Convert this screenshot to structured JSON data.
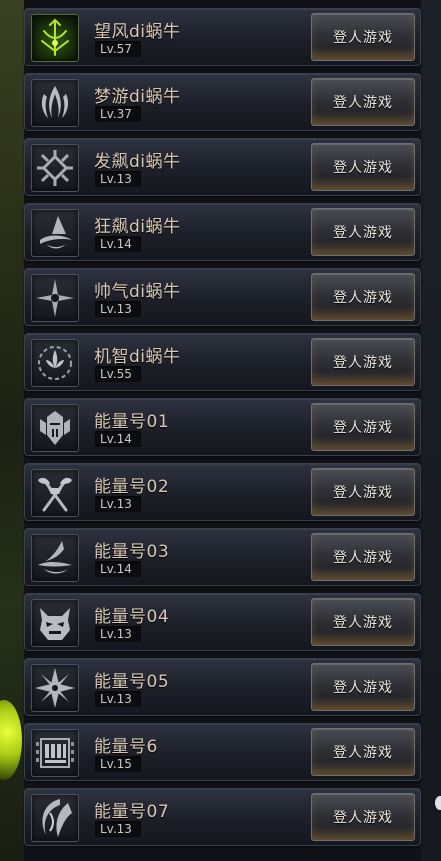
{
  "characters": [
    {
      "name": "望风di蜗牛",
      "level": "Lv.57",
      "button": "登人游戏",
      "icon": "green-crossbow-emblem-icon"
    },
    {
      "name": "梦游di蜗牛",
      "level": "Lv.37",
      "button": "登人游戏",
      "icon": "flame-wing-emblem-icon"
    },
    {
      "name": "发飙di蜗牛",
      "level": "Lv.13",
      "button": "登人游戏",
      "icon": "knot-emblem-icon"
    },
    {
      "name": "狂飙di蜗牛",
      "level": "Lv.14",
      "button": "登人游戏",
      "icon": "witch-hat-emblem-icon"
    },
    {
      "name": "帅气di蜗牛",
      "level": "Lv.13",
      "button": "登人游戏",
      "icon": "star-cross-emblem-icon"
    },
    {
      "name": "机智di蜗牛",
      "level": "Lv.55",
      "button": "登人游戏",
      "icon": "flower-ring-emblem-icon"
    },
    {
      "name": "能量号01",
      "level": "Lv.14",
      "button": "登人游戏",
      "icon": "knight-helm-emblem-icon"
    },
    {
      "name": "能量号02",
      "level": "Lv.13",
      "button": "登人游戏",
      "icon": "crossed-axes-emblem-icon"
    },
    {
      "name": "能量号03",
      "level": "Lv.14",
      "button": "登人游戏",
      "icon": "wave-wing-emblem-icon"
    },
    {
      "name": "能量号04",
      "level": "Lv.13",
      "button": "登人游戏",
      "icon": "demon-mask-emblem-icon"
    },
    {
      "name": "能量号05",
      "level": "Lv.13",
      "button": "登人游戏",
      "icon": "shuriken-emblem-icon"
    },
    {
      "name": "能量号6",
      "level": "Lv.15",
      "button": "登人游戏",
      "icon": "mechanical-grid-emblem-icon"
    },
    {
      "name": "能量号07",
      "level": "Lv.13",
      "button": "登人游戏",
      "icon": "crescent-blade-emblem-icon"
    }
  ],
  "colors": {
    "name_text": "#d9c7b4",
    "button_text": "#ebe6dc",
    "accent_green": "#b6e62a"
  }
}
